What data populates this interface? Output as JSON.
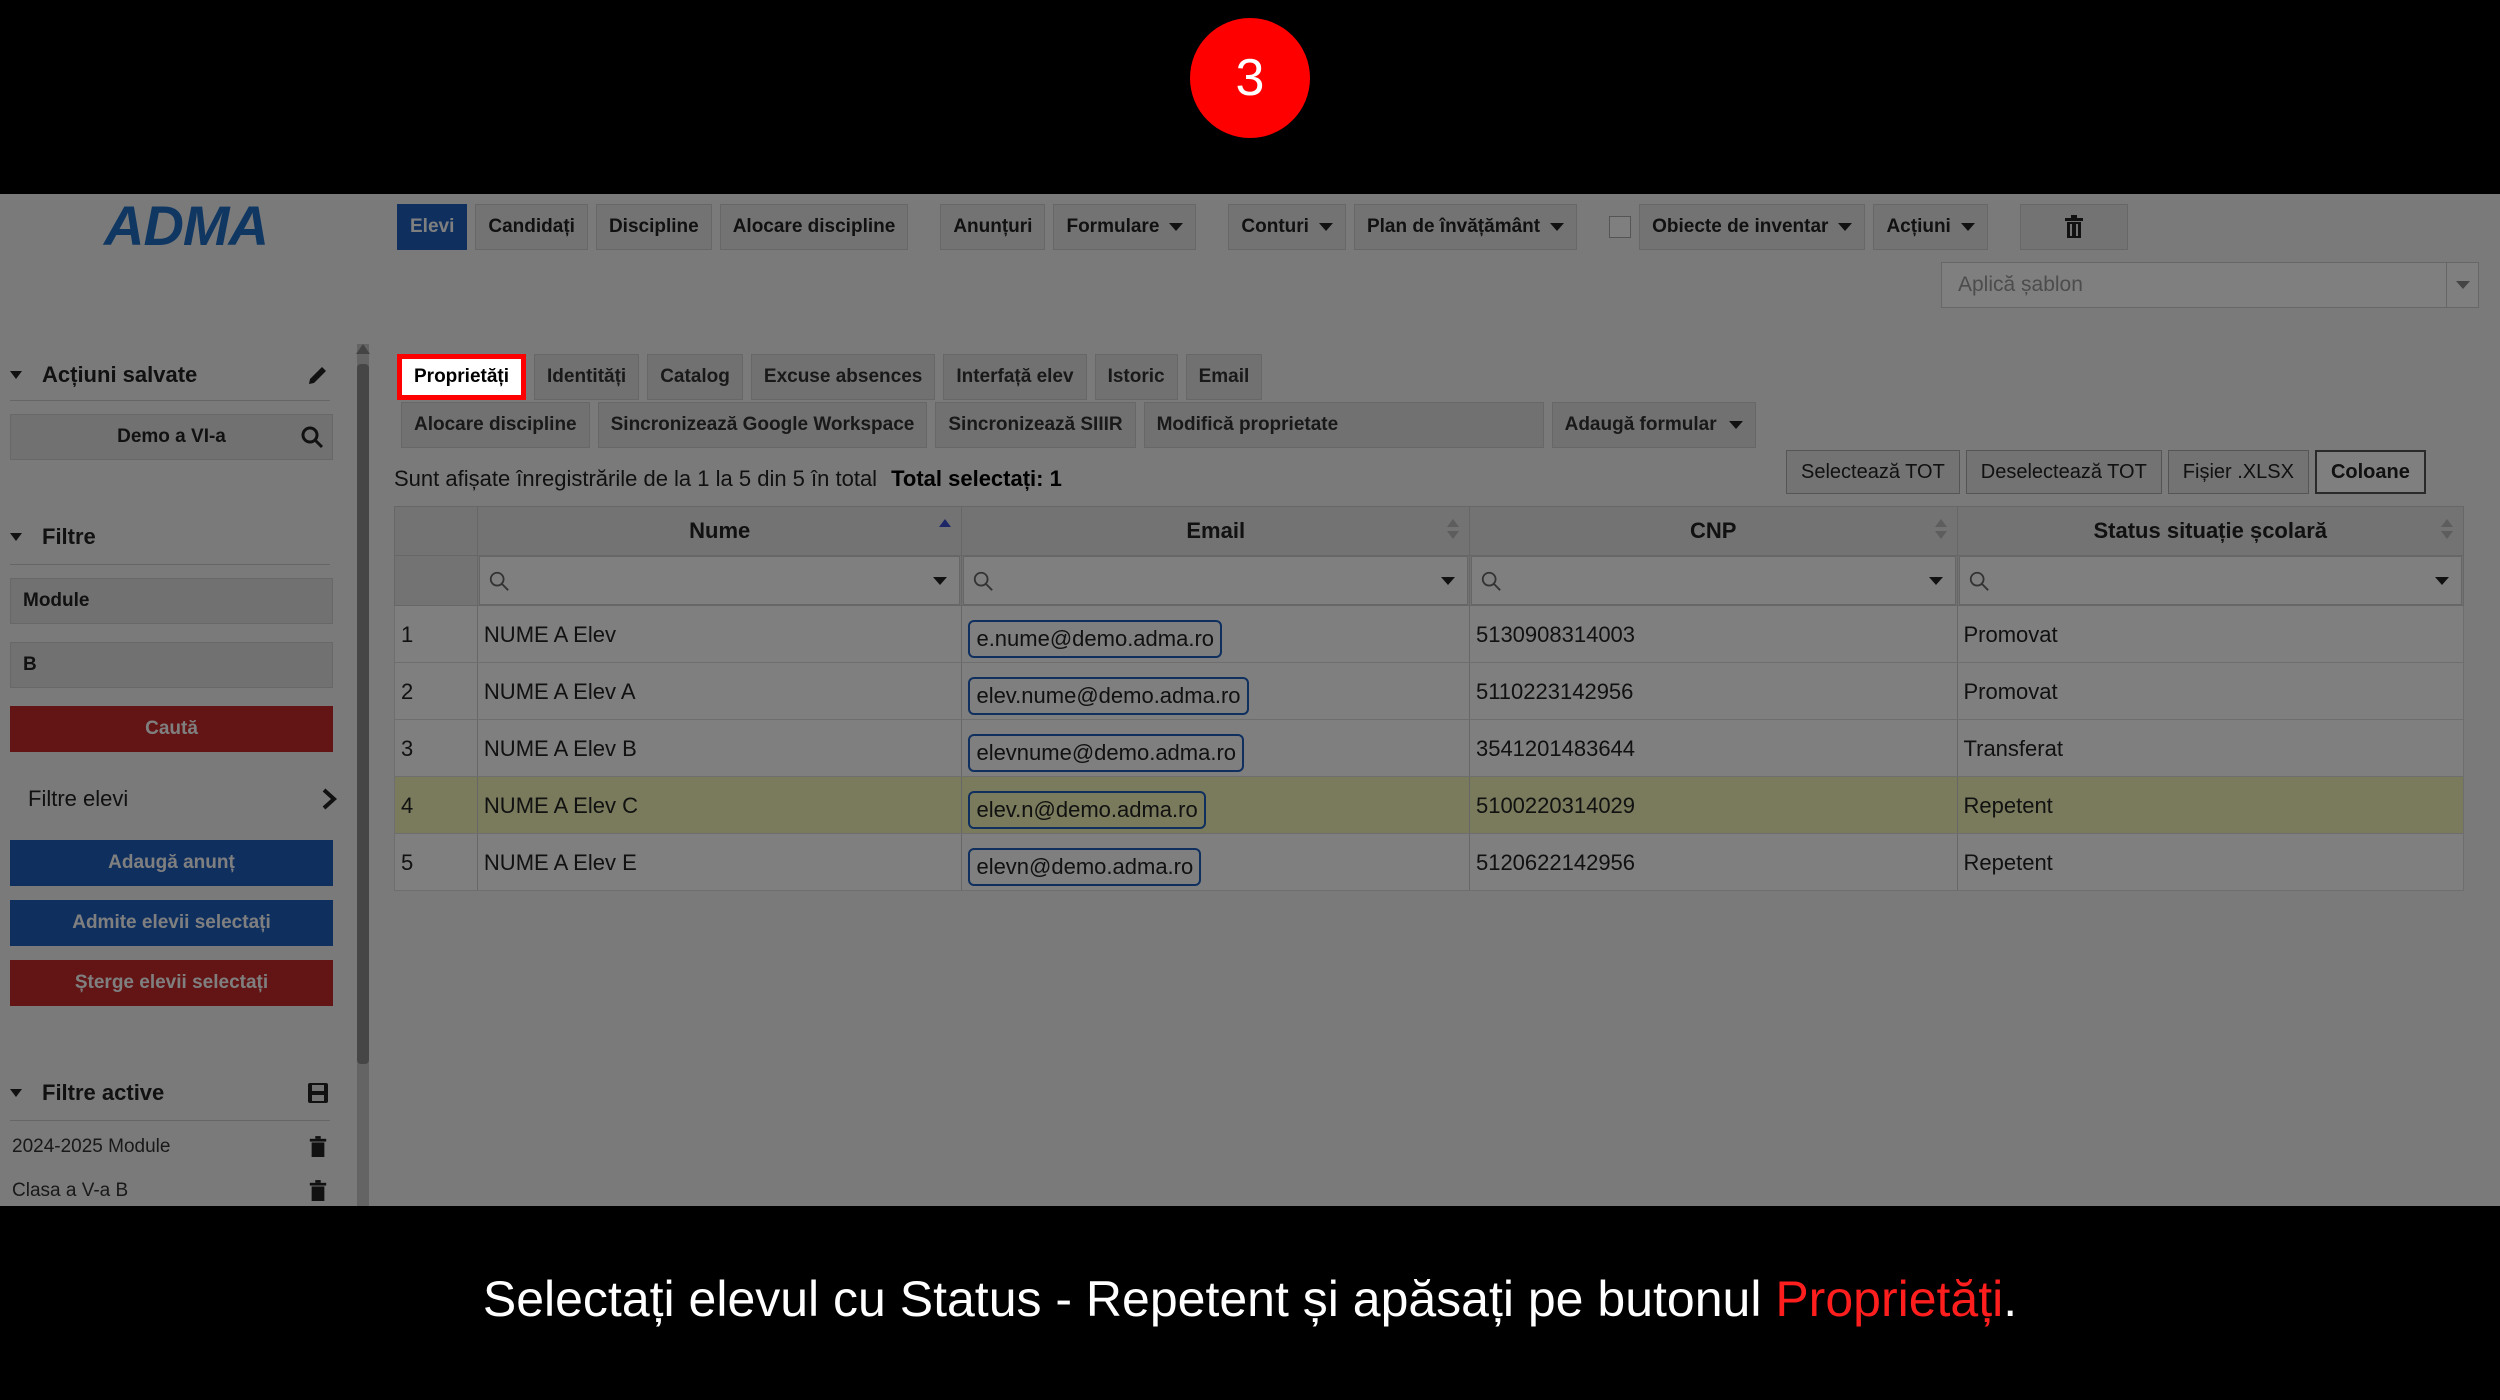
{
  "step_number": "3",
  "logo_text": "ADMA",
  "top_nav": [
    {
      "label": "Elevi",
      "active": true,
      "dropdown": false
    },
    {
      "label": "Candidați",
      "active": false,
      "dropdown": false
    },
    {
      "label": "Discipline",
      "active": false,
      "dropdown": false
    },
    {
      "label": "Alocare discipline",
      "active": false,
      "dropdown": false
    },
    {
      "label": "Anunțuri",
      "active": false,
      "dropdown": false
    },
    {
      "label": "Formulare",
      "active": false,
      "dropdown": true
    },
    {
      "label": "Conturi",
      "active": false,
      "dropdown": true
    },
    {
      "label": "Plan de învățământ",
      "active": false,
      "dropdown": true
    },
    {
      "label": "Obiecte de inventar",
      "active": false,
      "dropdown": true
    },
    {
      "label": "Acțiuni",
      "active": false,
      "dropdown": true
    }
  ],
  "template_select": {
    "placeholder": "Aplică șablon"
  },
  "sidebar": {
    "saved_actions_title": "Acțiuni salvate",
    "saved_search_value": "Demo a VI-a",
    "filters_title": "Filtre",
    "filter_module": "Module",
    "filter_b": "B",
    "search_button": "Caută",
    "student_filters": "Filtre elevi",
    "add_announcement": "Adaugă anunț",
    "admit_selected": "Admite elevii selectați",
    "delete_selected": "Șterge elevii selectați",
    "active_filters_title": "Filtre active",
    "active_filters": [
      "2024-2025 Module",
      "Clasa a V-a B"
    ]
  },
  "sub_tabs": [
    "Proprietăți",
    "Identități",
    "Catalog",
    "Excuse absences",
    "Interfață elev",
    "Istoric",
    "Email"
  ],
  "sub_tabs2": {
    "alloc": "Alocare discipline",
    "google": "Sincronizează Google Workspace",
    "siiir": "Sincronizează SIIIR",
    "modify": "Modifică proprietate",
    "add_form": "Adaugă formular"
  },
  "info_text": "Sunt afișate înregistrările de la 1 la 5 din 5 în total",
  "total_selected": "Total selectați: 1",
  "right_actions": {
    "select_all": "Selectează TOT",
    "deselect_all": "Deselectează TOT",
    "xlsx": "Fișier .XLSX",
    "columns": "Coloane"
  },
  "table": {
    "columns": [
      "Nume",
      "Email",
      "CNP",
      "Status situație școlară"
    ],
    "rows": [
      {
        "n": "1",
        "name": "NUME A Elev",
        "email": "e.nume@demo.adma.ro",
        "cnp": "5130908314003",
        "status": "Promovat"
      },
      {
        "n": "2",
        "name": "NUME A Elev A",
        "email": "elev.nume@demo.adma.ro",
        "cnp": "5110223142956",
        "status": "Promovat"
      },
      {
        "n": "3",
        "name": "NUME A Elev B",
        "email": "elevnume@demo.adma.ro",
        "cnp": "3541201483644",
        "status": "Transferat"
      },
      {
        "n": "4",
        "name": "NUME A Elev C",
        "email": "elev.n@demo.adma.ro",
        "cnp": "5100220314029",
        "status": "Repetent"
      },
      {
        "n": "5",
        "name": "NUME A Elev E",
        "email": "elevn@demo.adma.ro",
        "cnp": "5120622142956",
        "status": "Repetent"
      }
    ],
    "selected_row": 4
  },
  "caption": {
    "before": "Selectați elevul cu Status - Repetent și apăsați pe butonul ",
    "highlight": "Proprietăți",
    "after": "."
  },
  "colors": {
    "accent": "#1e5fbf",
    "danger": "#c62828",
    "highlight": "#ff0000",
    "selected_row": "#f4f6b8"
  }
}
